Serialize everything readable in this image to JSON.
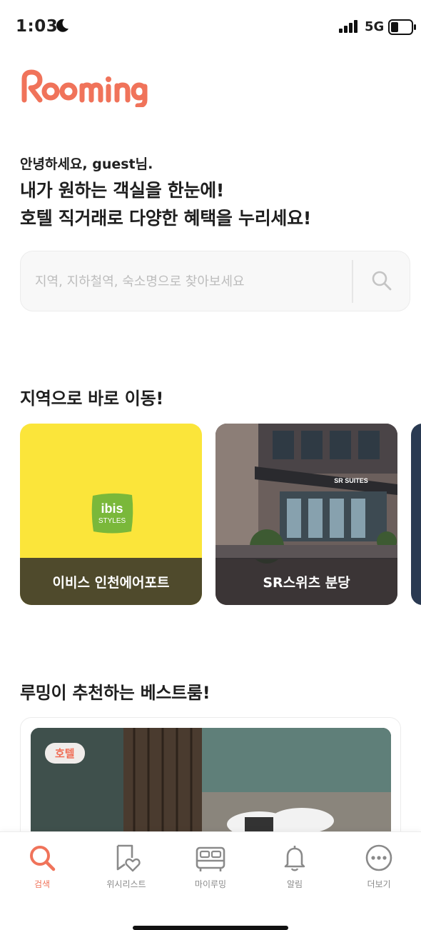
{
  "status_bar": {
    "time": "1:03",
    "network": "5G"
  },
  "app": {
    "logo_text": "Rooming",
    "brand_color": "#f0735a"
  },
  "greeting": {
    "small": "안녕하세요, guest님.",
    "line1": "내가 원하는 객실을 한눈에!",
    "line2": "호텔 직거래로 다양한 혜택을 누리세요!"
  },
  "search": {
    "placeholder": "지역, 지하철역, 숙소명으로 찾아보세요",
    "value": ""
  },
  "regions": {
    "title": "지역으로 바로 이동!",
    "cards": [
      {
        "label": "이비스 인천에어포트",
        "logo_text": "ibis",
        "logo_sub": "STYLES"
      },
      {
        "label": "SR스위츠 분당",
        "sign_text": "SR SUITES"
      }
    ]
  },
  "recommend": {
    "title": "루밍이 추천하는 베스트룸!",
    "badge": "호텔"
  },
  "tabs": [
    {
      "label": "검색",
      "icon": "search-icon"
    },
    {
      "label": "위시리스트",
      "icon": "wishlist-icon"
    },
    {
      "label": "마이루밍",
      "icon": "bed-icon"
    },
    {
      "label": "알림",
      "icon": "bell-icon"
    },
    {
      "label": "더보기",
      "icon": "more-icon"
    }
  ]
}
